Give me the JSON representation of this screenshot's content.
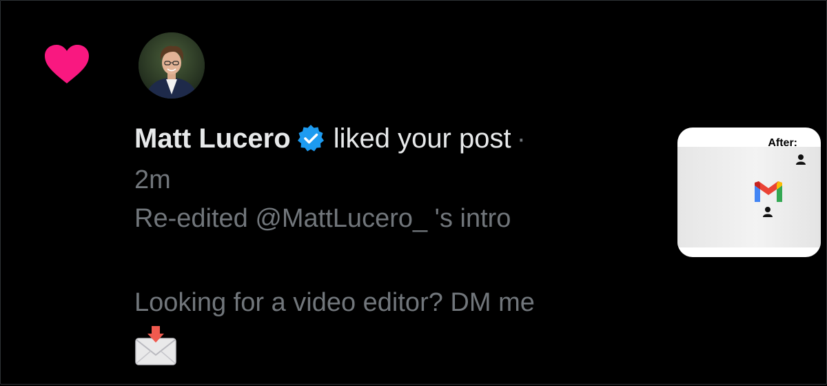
{
  "notification": {
    "type": "like",
    "heart_color": "#f91880",
    "author": {
      "name": "Matt Lucero",
      "verified": true,
      "verified_color": "#1d9bf0"
    },
    "action_text": "liked your post",
    "separator": "·",
    "time": "2m",
    "post": {
      "line1": "Re-edited @MattLucero_ 's intro",
      "line2": "Looking for a video editor? DM me",
      "emoji": "envelope-with-arrow-icon"
    },
    "thumbnail": {
      "label": "After:"
    }
  },
  "colors": {
    "background": "#000000",
    "primary_text": "#e7e9ea",
    "secondary_text": "#71767b"
  }
}
